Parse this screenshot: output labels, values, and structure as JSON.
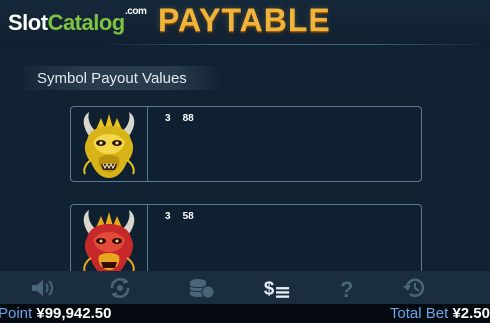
{
  "logo": {
    "part1": "Slot",
    "part2": "Catalog",
    "suffix": ".com"
  },
  "page_title": "PAYTABLE",
  "section_title": "Symbol Payout Values",
  "symbols": [
    {
      "name": "gold-dragon",
      "count": "3",
      "payout": "88"
    },
    {
      "name": "red-dragon",
      "count": "3",
      "payout": "58"
    }
  ],
  "toolbar": {
    "items": [
      "sound-icon",
      "autoplay-icon",
      "coins-icon",
      "paytable-icon",
      "help-icon",
      "history-icon"
    ]
  },
  "status": {
    "point_label": "Point",
    "point_value": "¥99,942.50",
    "bet_label": "Total Bet",
    "bet_value": "¥2.50"
  },
  "colors": {
    "title_gold": "#f0b43a",
    "logo_green": "#7ec242",
    "status_label_blue": "#6ba6e6",
    "card_border": "#5a7a98"
  }
}
